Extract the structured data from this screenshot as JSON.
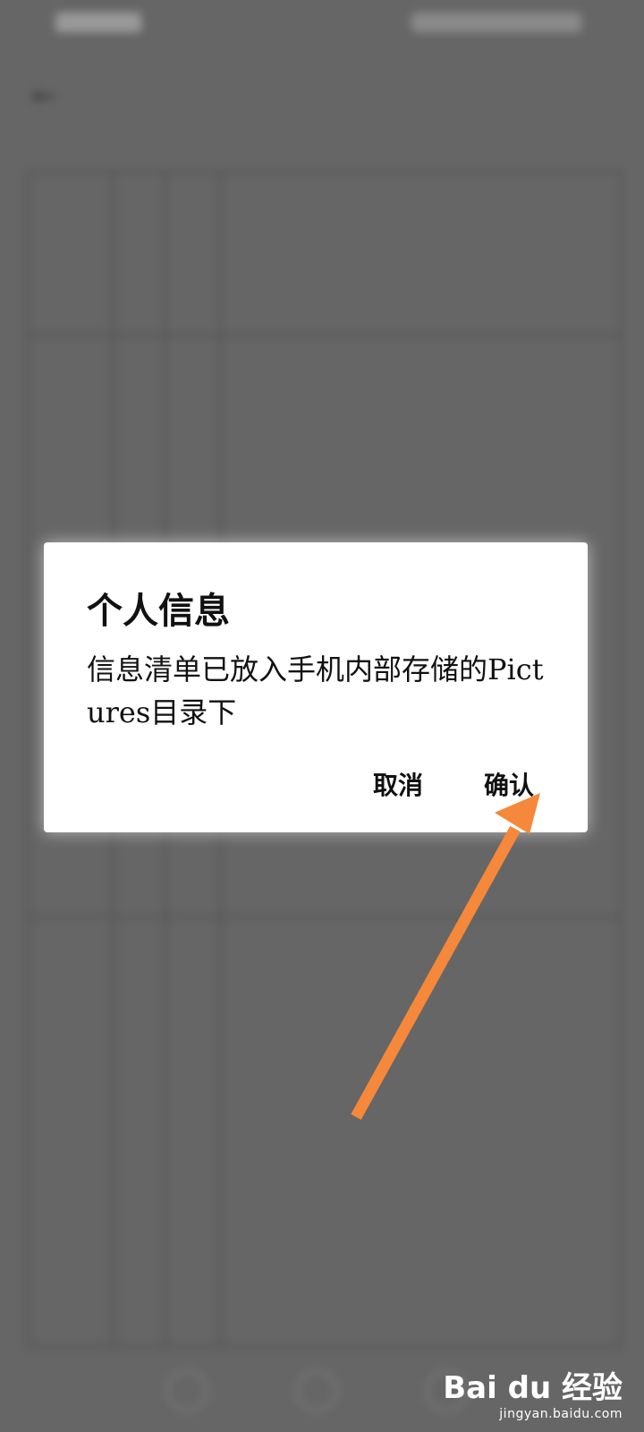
{
  "dialog": {
    "title": "个人信息",
    "message": "信息清单已放入手机内部存储的Pictures目录下",
    "cancel_label": "取消",
    "confirm_label": "确认"
  },
  "watermark": {
    "brand": "Bai du 经验",
    "url": "jingyan.baidu.com"
  },
  "colors": {
    "overlay": "#666666",
    "dialog_bg": "#ffffff",
    "arrow": "#f5883a"
  },
  "icons": {
    "back": "back-arrow-icon",
    "annotation": "pointer-arrow-icon"
  }
}
